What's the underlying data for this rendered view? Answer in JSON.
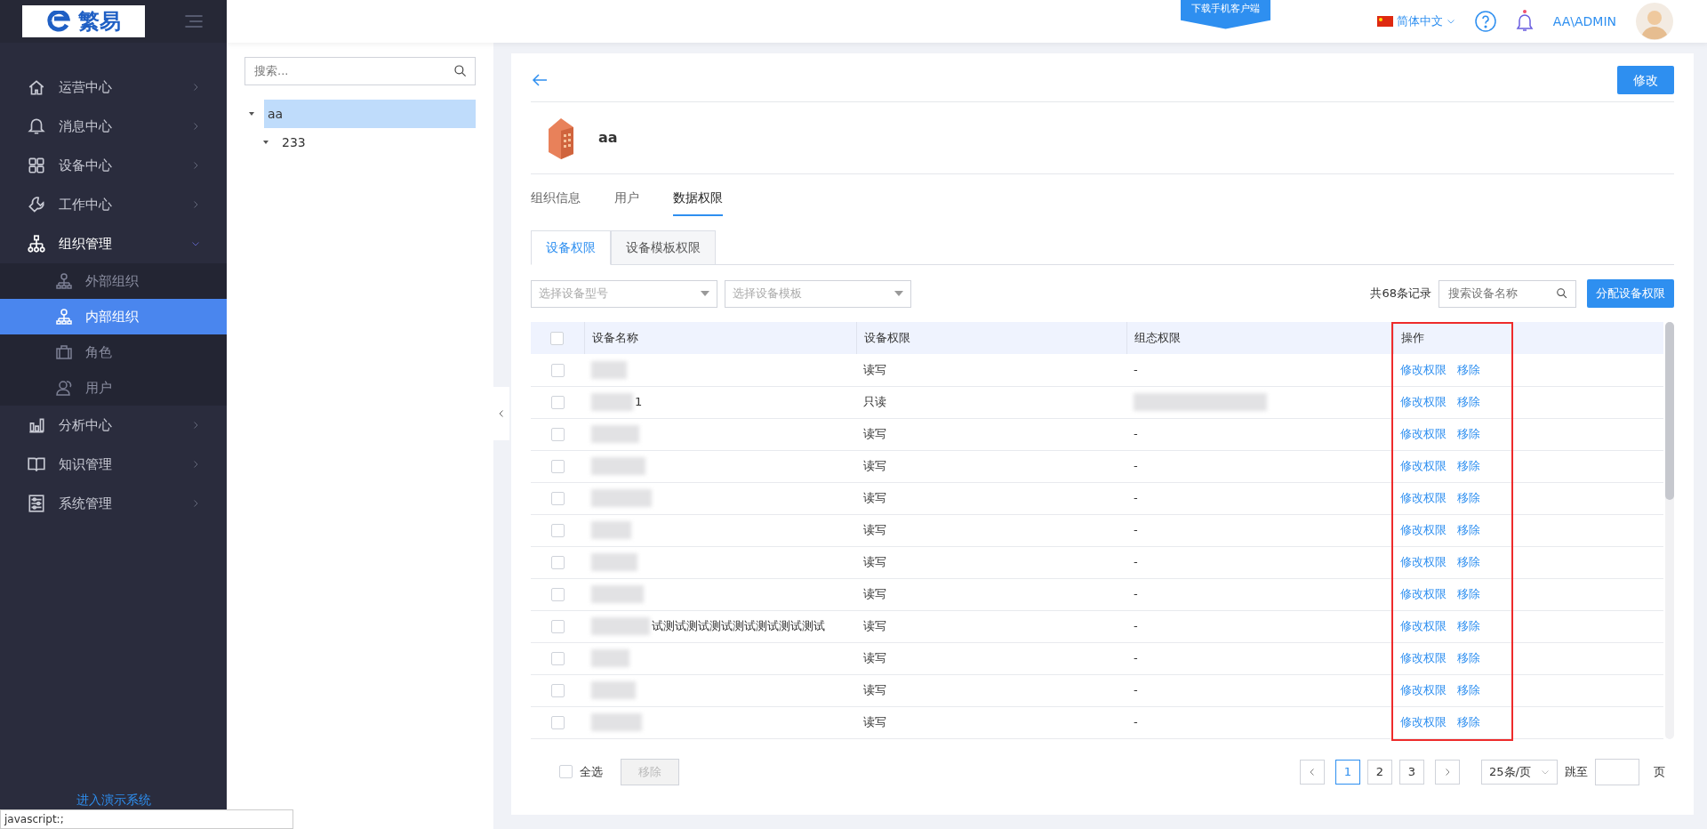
{
  "sidebar": {
    "logo": "繁易",
    "menu": [
      {
        "label": "运营中心",
        "expanded": false
      },
      {
        "label": "消息中心",
        "expanded": false
      },
      {
        "label": "设备中心",
        "expanded": false
      },
      {
        "label": "工作中心",
        "expanded": false
      },
      {
        "label": "组织管理",
        "expanded": true,
        "children": [
          {
            "label": "外部组织",
            "selected": false
          },
          {
            "label": "内部组织",
            "selected": true
          },
          {
            "label": "角色",
            "selected": false
          },
          {
            "label": "用户",
            "selected": false
          }
        ]
      },
      {
        "label": "分析中心",
        "expanded": false
      },
      {
        "label": "知识管理",
        "expanded": false
      },
      {
        "label": "系统管理",
        "expanded": false
      }
    ],
    "demo_link": "进入演示系统"
  },
  "header": {
    "download_button": "下载手机客户端",
    "language": "简体中文",
    "user": "AA\\ADMIN"
  },
  "tree": {
    "placeholder": "搜索...",
    "nodes": [
      {
        "label": "aa",
        "selected": true,
        "expanded": true,
        "children": [
          {
            "label": "233",
            "selected": false,
            "expanded": true
          }
        ]
      }
    ]
  },
  "detail": {
    "edit_button": "修改",
    "org_name": "aa",
    "tabs": [
      {
        "label": "组织信息",
        "selected": false
      },
      {
        "label": "用户",
        "selected": false
      },
      {
        "label": "数据权限",
        "selected": true
      }
    ],
    "subtabs": [
      {
        "label": "设备权限",
        "selected": true
      },
      {
        "label": "设备模板权限",
        "selected": false
      }
    ],
    "filters": [
      {
        "placeholder": "选择设备型号"
      },
      {
        "placeholder": "选择设备模板"
      }
    ],
    "record_count": "共68条记录",
    "search_placeholder": "搜索设备名称",
    "assign_button": "分配设备权限",
    "table": {
      "header_checked": false,
      "columns": [
        {
          "label": "设备名称",
          "highlighted": false
        },
        {
          "label": "设备权限",
          "highlighted": false
        },
        {
          "label": "组态权限",
          "highlighted": false
        },
        {
          "label": "操作",
          "highlighted": true
        }
      ],
      "rows": [
        {
          "checked": false,
          "name_redacted": true,
          "permission": "读写",
          "config": "-",
          "config_redacted": false,
          "actions": [
            "修改权限",
            "移除"
          ]
        },
        {
          "checked": false,
          "name": "1",
          "name_redacted": true,
          "permission": "只读",
          "config_redacted": true,
          "actions": [
            "修改权限",
            "移除"
          ]
        },
        {
          "checked": false,
          "name_redacted": true,
          "permission": "读写",
          "config": "-",
          "config_redacted": false,
          "actions": [
            "修改权限",
            "移除"
          ]
        },
        {
          "checked": false,
          "name_redacted": true,
          "permission": "读写",
          "config": "-",
          "config_redacted": false,
          "actions": [
            "修改权限",
            "移除"
          ]
        },
        {
          "checked": false,
          "name_redacted": true,
          "permission": "读写",
          "config": "-",
          "config_redacted": false,
          "actions": [
            "修改权限",
            "移除"
          ]
        },
        {
          "checked": false,
          "name_redacted": true,
          "permission": "读写",
          "config": "-",
          "config_redacted": false,
          "actions": [
            "修改权限",
            "移除"
          ]
        },
        {
          "checked": false,
          "name_redacted": true,
          "permission": "读写",
          "config": "-",
          "config_redacted": false,
          "actions": [
            "修改权限",
            "移除"
          ]
        },
        {
          "checked": false,
          "name_redacted": true,
          "permission": "读写",
          "config": "-",
          "config_redacted": false,
          "actions": [
            "修改权限",
            "移除"
          ]
        },
        {
          "checked": false,
          "name": "试测试测试测试测试测试测试测试",
          "name_redacted": true,
          "permission": "读写",
          "config": "-",
          "config_redacted": false,
          "actions": [
            "修改权限",
            "移除"
          ]
        },
        {
          "checked": false,
          "name_redacted": true,
          "permission": "读写",
          "config": "-",
          "config_redacted": false,
          "actions": [
            "修改权限",
            "移除"
          ]
        },
        {
          "checked": false,
          "name_redacted": true,
          "permission": "读写",
          "config": "-",
          "config_redacted": false,
          "actions": [
            "修改权限",
            "移除"
          ]
        },
        {
          "checked": false,
          "name_redacted": true,
          "permission": "读写",
          "config": "-",
          "config_redacted": false,
          "actions": [
            "修改权限",
            "移除"
          ]
        }
      ]
    },
    "footer": {
      "select_all": "全选",
      "select_all_checked": false,
      "remove_button": "移除",
      "remove_disabled": true,
      "pages": [
        {
          "label": "1",
          "selected": true
        },
        {
          "label": "2",
          "selected": false
        },
        {
          "label": "3",
          "selected": false
        }
      ],
      "page_size": "25条/页",
      "jump_label": "跳至",
      "page_unit": "页"
    }
  },
  "status_bar": "javascript:;"
}
